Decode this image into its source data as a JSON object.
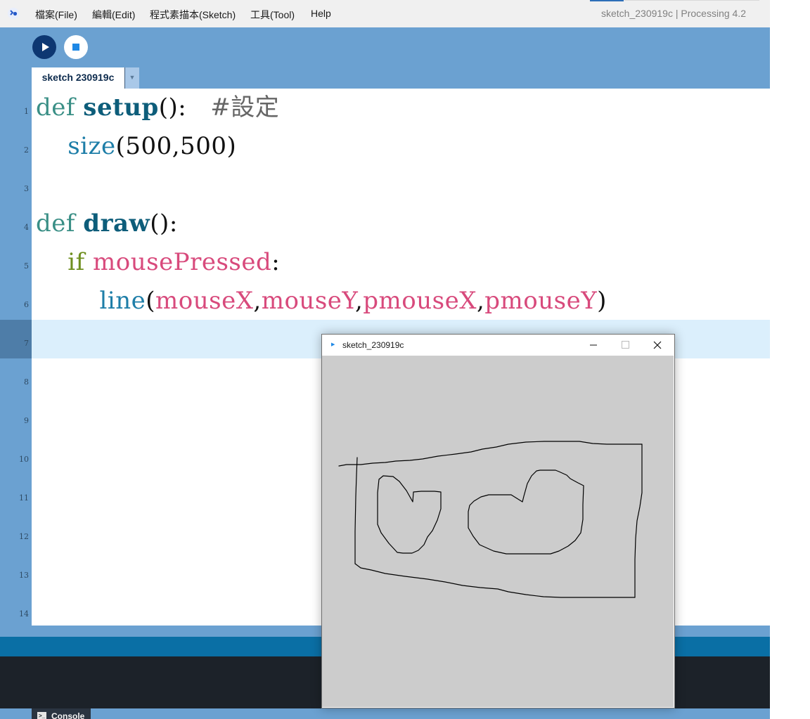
{
  "menubar": {
    "items": [
      "檔案(File)",
      "編輯(Edit)",
      "程式素描本(Sketch)",
      "工具(Tool)",
      "Help"
    ],
    "window_title": "sketch_230919c | Processing 4.2"
  },
  "toolbar": {
    "run_icon": "play-icon",
    "stop_icon": "stop-icon",
    "tab_label": "sketch 230919c",
    "tab_menu_glyph": "▼"
  },
  "editor": {
    "line_numbers": [
      "1",
      "2",
      "3",
      "4",
      "5",
      "6",
      "7",
      "8",
      "9",
      "10",
      "11",
      "12",
      "13",
      "14"
    ],
    "current_line": 7,
    "code": {
      "l1_kw": "def",
      "l1_name": "setup",
      "l1_rest": "():   ",
      "l1_comment": "#設定",
      "l2_fn": "size",
      "l2_args": "(500,500)",
      "l4_kw": "def",
      "l4_name": "draw",
      "l4_rest": "():",
      "l5_kw": "if",
      "l5_var": "mousePressed",
      "l5_rest": ":",
      "l6_fn": "line",
      "l6_open": "(",
      "l6_a1": "mouseX",
      "l6_c1": ",",
      "l6_a2": "mouseY",
      "l6_c2": ",",
      "l6_a3": "pmouseX",
      "l6_c3": ",",
      "l6_a4": "pmouseY",
      "l6_close": ")"
    }
  },
  "console": {
    "tab_label": "Console",
    "icon": "console-icon"
  },
  "sketch_window": {
    "title": "sketch_230919c",
    "icon": "processing-icon",
    "minimize_icon": "minimize-icon",
    "maximize_icon": "maximize-icon",
    "close_icon": "close-icon",
    "canvas_background": "#cccccc"
  },
  "colors": {
    "toolbar_blue": "#6ba1d1",
    "run_button": "#0d3772",
    "status_bar": "#0a6fa5",
    "console_bg": "#1c2229",
    "current_line": "#dbeffc"
  }
}
